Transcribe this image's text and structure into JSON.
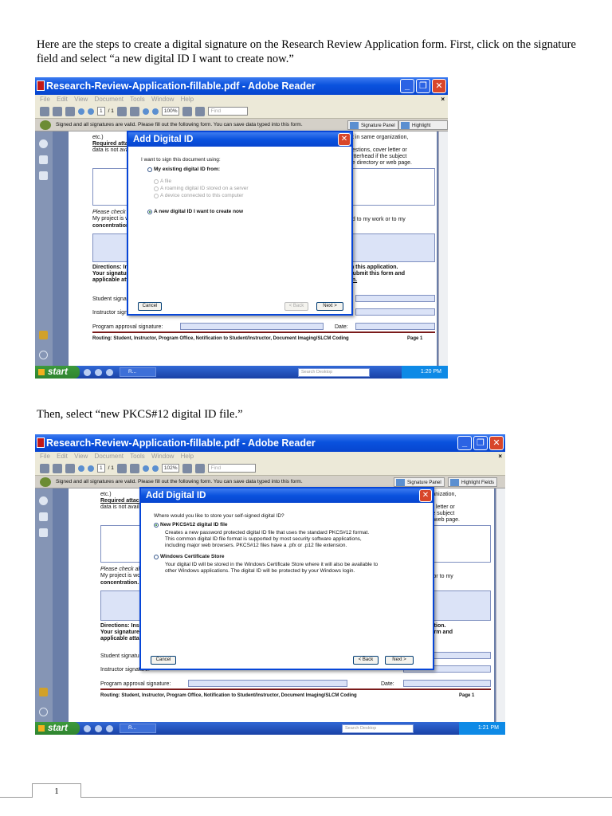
{
  "instructions": {
    "step1": "Here are the steps to create a digital signature on the Research Review Application form.  First, click on the signature field and select “a new digital ID I want to create now.”",
    "step2": "Then, select “new PKCS#12 digital ID file.”"
  },
  "window": {
    "title": "Research-Review-Application-fillable.pdf - Adobe Reader",
    "menu": "File Edit View Document Tools Window Help",
    "page_field": "1",
    "page_total": "/ 1",
    "search_placeholder": "Find"
  },
  "shot1": {
    "zoom": "100%",
    "clock": "1:20 PM"
  },
  "shot2": {
    "zoom": "102%",
    "clock": "1:21 PM"
  },
  "sigbar": {
    "message": "Signed and all signatures are valid.  Please fill out the following form. You can save data typed into this form.",
    "signature_panel": "Signature Panel",
    "highlight_fields": "Highlight Fields"
  },
  "document": {
    "etc": "etc.)",
    "required": "Required attachments:",
    "not_available": "data is not available to th",
    "right1": "rk in same organization,",
    "right2": "uestions, cover letter or",
    "right3": "letterhead if the subject",
    "right4": "ne directory or web page.",
    "check_all": "Please check all that",
    "project": "My project is wo",
    "project_right": "ed to my work or to my",
    "concentration": "concentration.  Plea",
    "directions": "Directions:  Insert di",
    "directions_right": "in this application.",
    "signature_also": "Your signature also",
    "submit": "Submit this form and",
    "applicable": "applicable attachm",
    "en": "en.",
    "student": "Student signature:",
    "instructor": "Instructor signature:",
    "program": "Program approval signature:",
    "date": "Date:",
    "routing": "Routing: Student, Instructor, Program Office, Notification to Student/Instructor, Document Imaging/SLCM Coding",
    "page_label": "Page 1"
  },
  "dialog1": {
    "title": "Add Digital ID",
    "prompt": "I want to sign this document using:",
    "opt_existing": "My existing digital ID from:",
    "opt_file": "A file",
    "opt_roaming": "A roaming digital ID stored on a server",
    "opt_device": "A device connected to this computer",
    "opt_new": "A new digital ID I want to create now",
    "cancel": "Cancel",
    "back": "< Back",
    "next": "Next >"
  },
  "dialog2": {
    "title": "Add Digital ID",
    "prompt": "Where would you like to store your self-signed digital ID?",
    "opt_pkcs": "New PKCS#12 digital ID file",
    "pkcs_desc": "Creates a new password protected digital ID file that uses the standard PKCS#12 format. This common digital ID file format is supported by most security software applications, including major web browsers. PKCS#12 files have a .pfx or .p12 file extension.",
    "opt_store": "Windows Certificate Store",
    "store_desc": "Your digital ID will be stored in the Windows Certificate Store where it will also be available to other Windows applications. The digital ID will be protected by your Windows login.",
    "cancel": "Cancel",
    "back": "< Back",
    "next": "Next >"
  },
  "taskbar": {
    "start": "start",
    "task": "R...",
    "search": "Search Desktop"
  },
  "footer": {
    "page_number": "1"
  }
}
